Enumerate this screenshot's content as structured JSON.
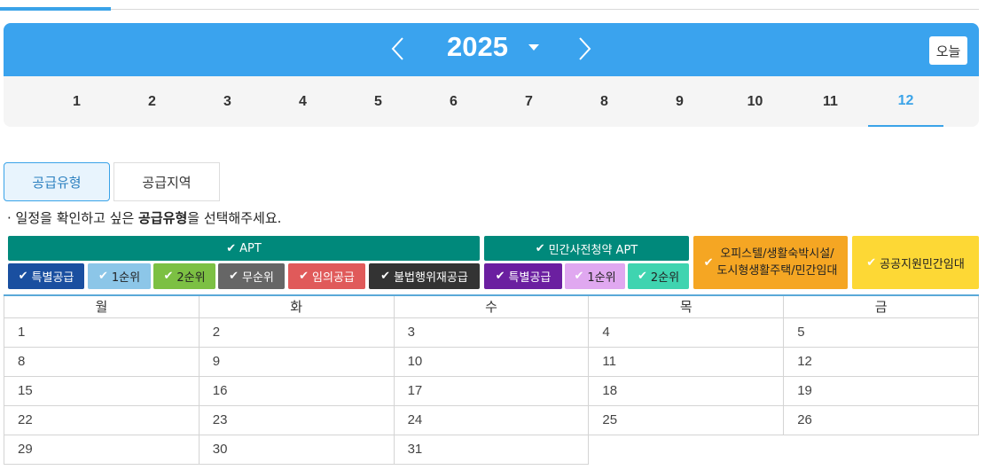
{
  "header": {
    "year": "2025",
    "today_label": "오늘",
    "months": [
      "1",
      "2",
      "3",
      "4",
      "5",
      "6",
      "7",
      "8",
      "9",
      "10",
      "11",
      "12"
    ],
    "active_month": "12"
  },
  "tabs": [
    {
      "label": "공급유형",
      "active": true
    },
    {
      "label": "공급지역",
      "active": false
    }
  ],
  "notice": {
    "prefix": "· 일정을 확인하고 싶은 ",
    "bold": "공급유형",
    "suffix": "을 선택해주세요."
  },
  "legend": {
    "apt_header": "APT",
    "private_header": "민간사전청약 APT",
    "officetel": "오피스텔/생활숙박시설/",
    "officetel_line2": "도시형생활주택/민간임대",
    "public_rental": "공공지원민간임대",
    "apt_items": [
      {
        "label": "특별공급",
        "color": "#1a4fa0"
      },
      {
        "label": "1순위",
        "color": "#8cc6e8"
      },
      {
        "label": "2순위",
        "color": "#7cc043"
      },
      {
        "label": "무순위",
        "color": "#666666"
      },
      {
        "label": "임의공급",
        "color": "#e05a5a"
      },
      {
        "label": "불법행위재공급",
        "color": "#333333"
      }
    ],
    "private_items": [
      {
        "label": "특별공급",
        "color": "#6b1fa0"
      },
      {
        "label": "1순위",
        "color": "#e0a8f0"
      },
      {
        "label": "2순위",
        "color": "#3fd4b0"
      }
    ],
    "colors": {
      "apt_header": "#00897b",
      "private_header": "#00897b",
      "officetel": "#f5a623",
      "public_rental": "#fdd835"
    }
  },
  "calendar": {
    "weekdays": [
      "월",
      "화",
      "수",
      "목",
      "금"
    ],
    "weeks": [
      [
        "1",
        "2",
        "3",
        "4",
        "5"
      ],
      [
        "8",
        "9",
        "10",
        "11",
        "12"
      ],
      [
        "15",
        "16",
        "17",
        "18",
        "19"
      ],
      [
        "22",
        "23",
        "24",
        "25",
        "26"
      ],
      [
        "29",
        "30",
        "31",
        "",
        ""
      ]
    ]
  }
}
